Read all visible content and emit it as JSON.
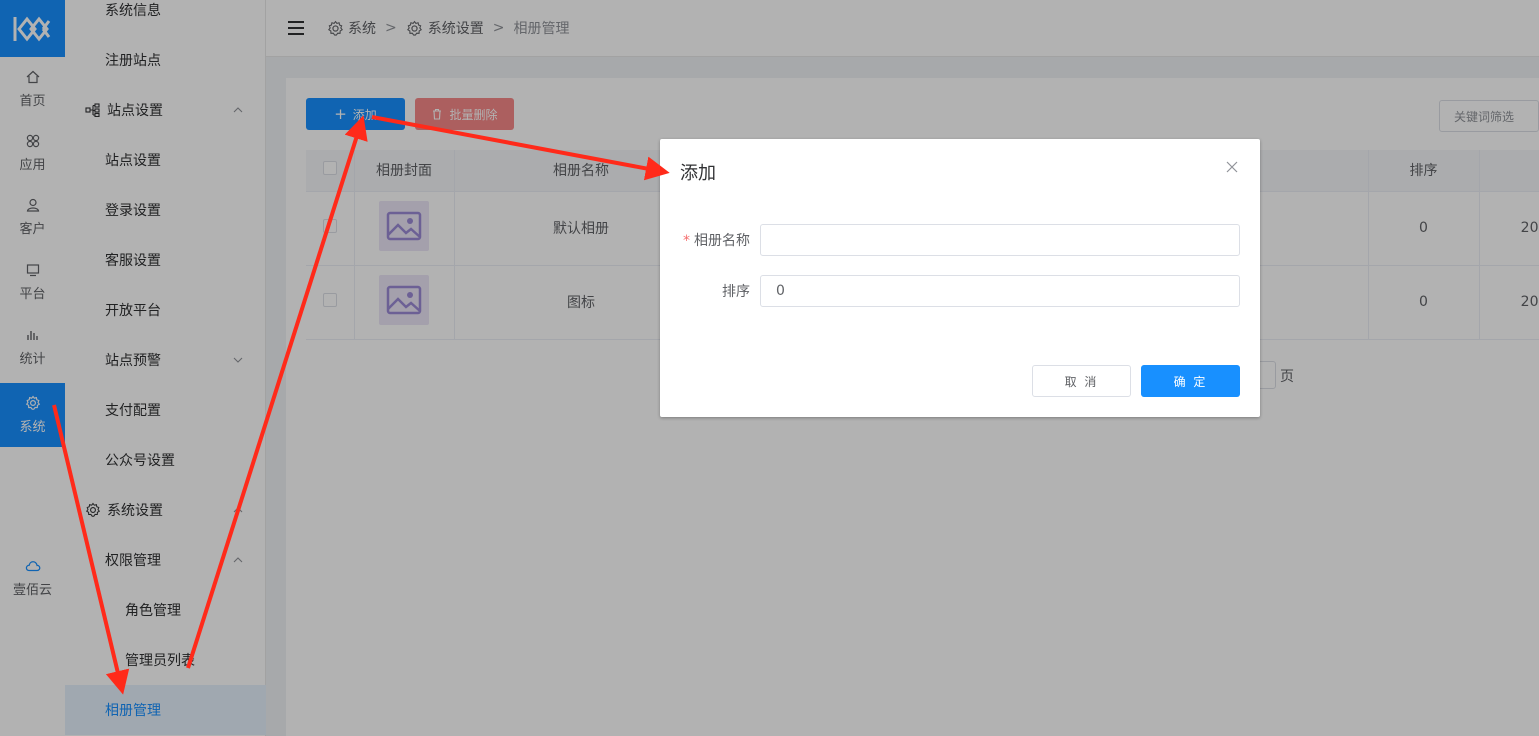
{
  "rail": {
    "items": [
      {
        "label": "首页",
        "icon": "home-icon"
      },
      {
        "label": "应用",
        "icon": "apps-icon"
      },
      {
        "label": "客户",
        "icon": "user-icon"
      },
      {
        "label": "平台",
        "icon": "monitor-icon"
      },
      {
        "label": "统计",
        "icon": "bar-chart-icon"
      },
      {
        "label": "系统",
        "icon": "gear-icon"
      }
    ],
    "cloud_label": "壹佰云"
  },
  "submenu": {
    "items": [
      {
        "label": "系统信息"
      },
      {
        "label": "注册站点"
      },
      {
        "label": "站点设置"
      },
      {
        "label": "站点设置"
      },
      {
        "label": "登录设置"
      },
      {
        "label": "客服设置"
      },
      {
        "label": "开放平台"
      },
      {
        "label": "站点预警"
      },
      {
        "label": "支付配置"
      },
      {
        "label": "公众号设置"
      },
      {
        "label": "系统设置"
      },
      {
        "label": "权限管理"
      },
      {
        "label": "角色管理"
      },
      {
        "label": "管理员列表"
      },
      {
        "label": "相册管理"
      }
    ]
  },
  "breadcrumb": {
    "items": [
      "系统",
      "系统设置",
      "相册管理"
    ],
    "separator": ">"
  },
  "toolbar": {
    "add_label": "添加",
    "batch_delete_label": "批量删除",
    "filter_label": "关键词筛选"
  },
  "table": {
    "columns": [
      "相册封面",
      "相册名称",
      "排序"
    ],
    "rows": [
      {
        "name": "默认相册",
        "sort": "0",
        "extra": "20"
      },
      {
        "name": "图标",
        "sort": "0",
        "extra": "20"
      }
    ]
  },
  "pagination": {
    "page_suffix": "页"
  },
  "dialog": {
    "title": "添加",
    "fields": {
      "name_label": "相册名称",
      "name_value": "",
      "sort_label": "排序",
      "sort_value": "0"
    },
    "cancel_label": "取 消",
    "confirm_label": "确 定"
  },
  "colors": {
    "primary": "#1890ff",
    "danger": "#f78989",
    "annotation": "#ff2a1a"
  }
}
